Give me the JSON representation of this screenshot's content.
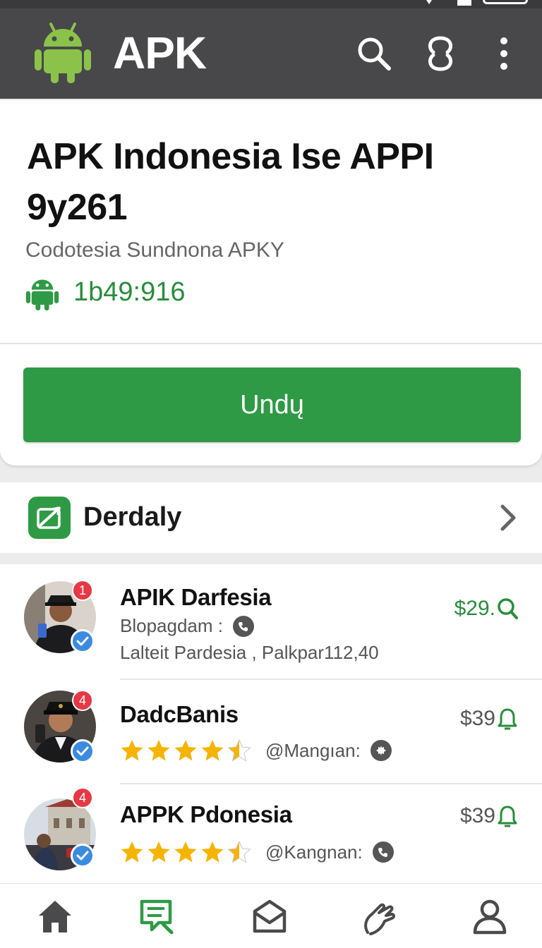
{
  "colors": {
    "app_bar": "#48484b",
    "accent_green": "#2f9a45",
    "android_green": "#8bc34a",
    "notif_red": "#e53945",
    "verify_blue": "#3b8be0",
    "star_yellow": "#f5b400"
  },
  "app_bar": {
    "logo_icon": "android-icon",
    "title": "APK",
    "actions": [
      "search-icon",
      "sync-icon",
      "more-vert-icon"
    ]
  },
  "app_info": {
    "name": "APK Indonesia Ise APPI 9y261",
    "subtitle": "Codotesia Sundnona APKY",
    "version_icon": "android-icon",
    "version": "1b49:916",
    "download_label": "Undų"
  },
  "category": {
    "icon": "category-icon",
    "label": "Derdaly",
    "chevron": "chevron-right-icon"
  },
  "list": {
    "items": [
      {
        "title": "APIK Darfesia",
        "badge": "1",
        "subtitle": "Blopagdam :",
        "subtitle_icon": "phone-icon",
        "detail": "Lalteit Pardesia , Palkpar112,40",
        "price": "$29.",
        "price_icon": "search-icon",
        "verified": true
      },
      {
        "title": "DadcBanis",
        "badge": "4",
        "rating": 4.5,
        "handle": "@Mangıan:",
        "handle_icon": "gear-icon",
        "price": "$39",
        "price_icon": "bell-icon",
        "verified": true
      },
      {
        "title": "APPK Pdonesia",
        "badge": "4",
        "rating": 4.5,
        "handle": "@Kangnan:",
        "handle_icon": "phone-icon",
        "price": "$39",
        "price_icon": "bell-icon",
        "verified": true
      }
    ]
  },
  "bottom_nav": {
    "items": [
      "home-icon",
      "chat-icon",
      "mail-icon",
      "hand-icon",
      "profile-icon"
    ],
    "active": "chat-icon"
  }
}
